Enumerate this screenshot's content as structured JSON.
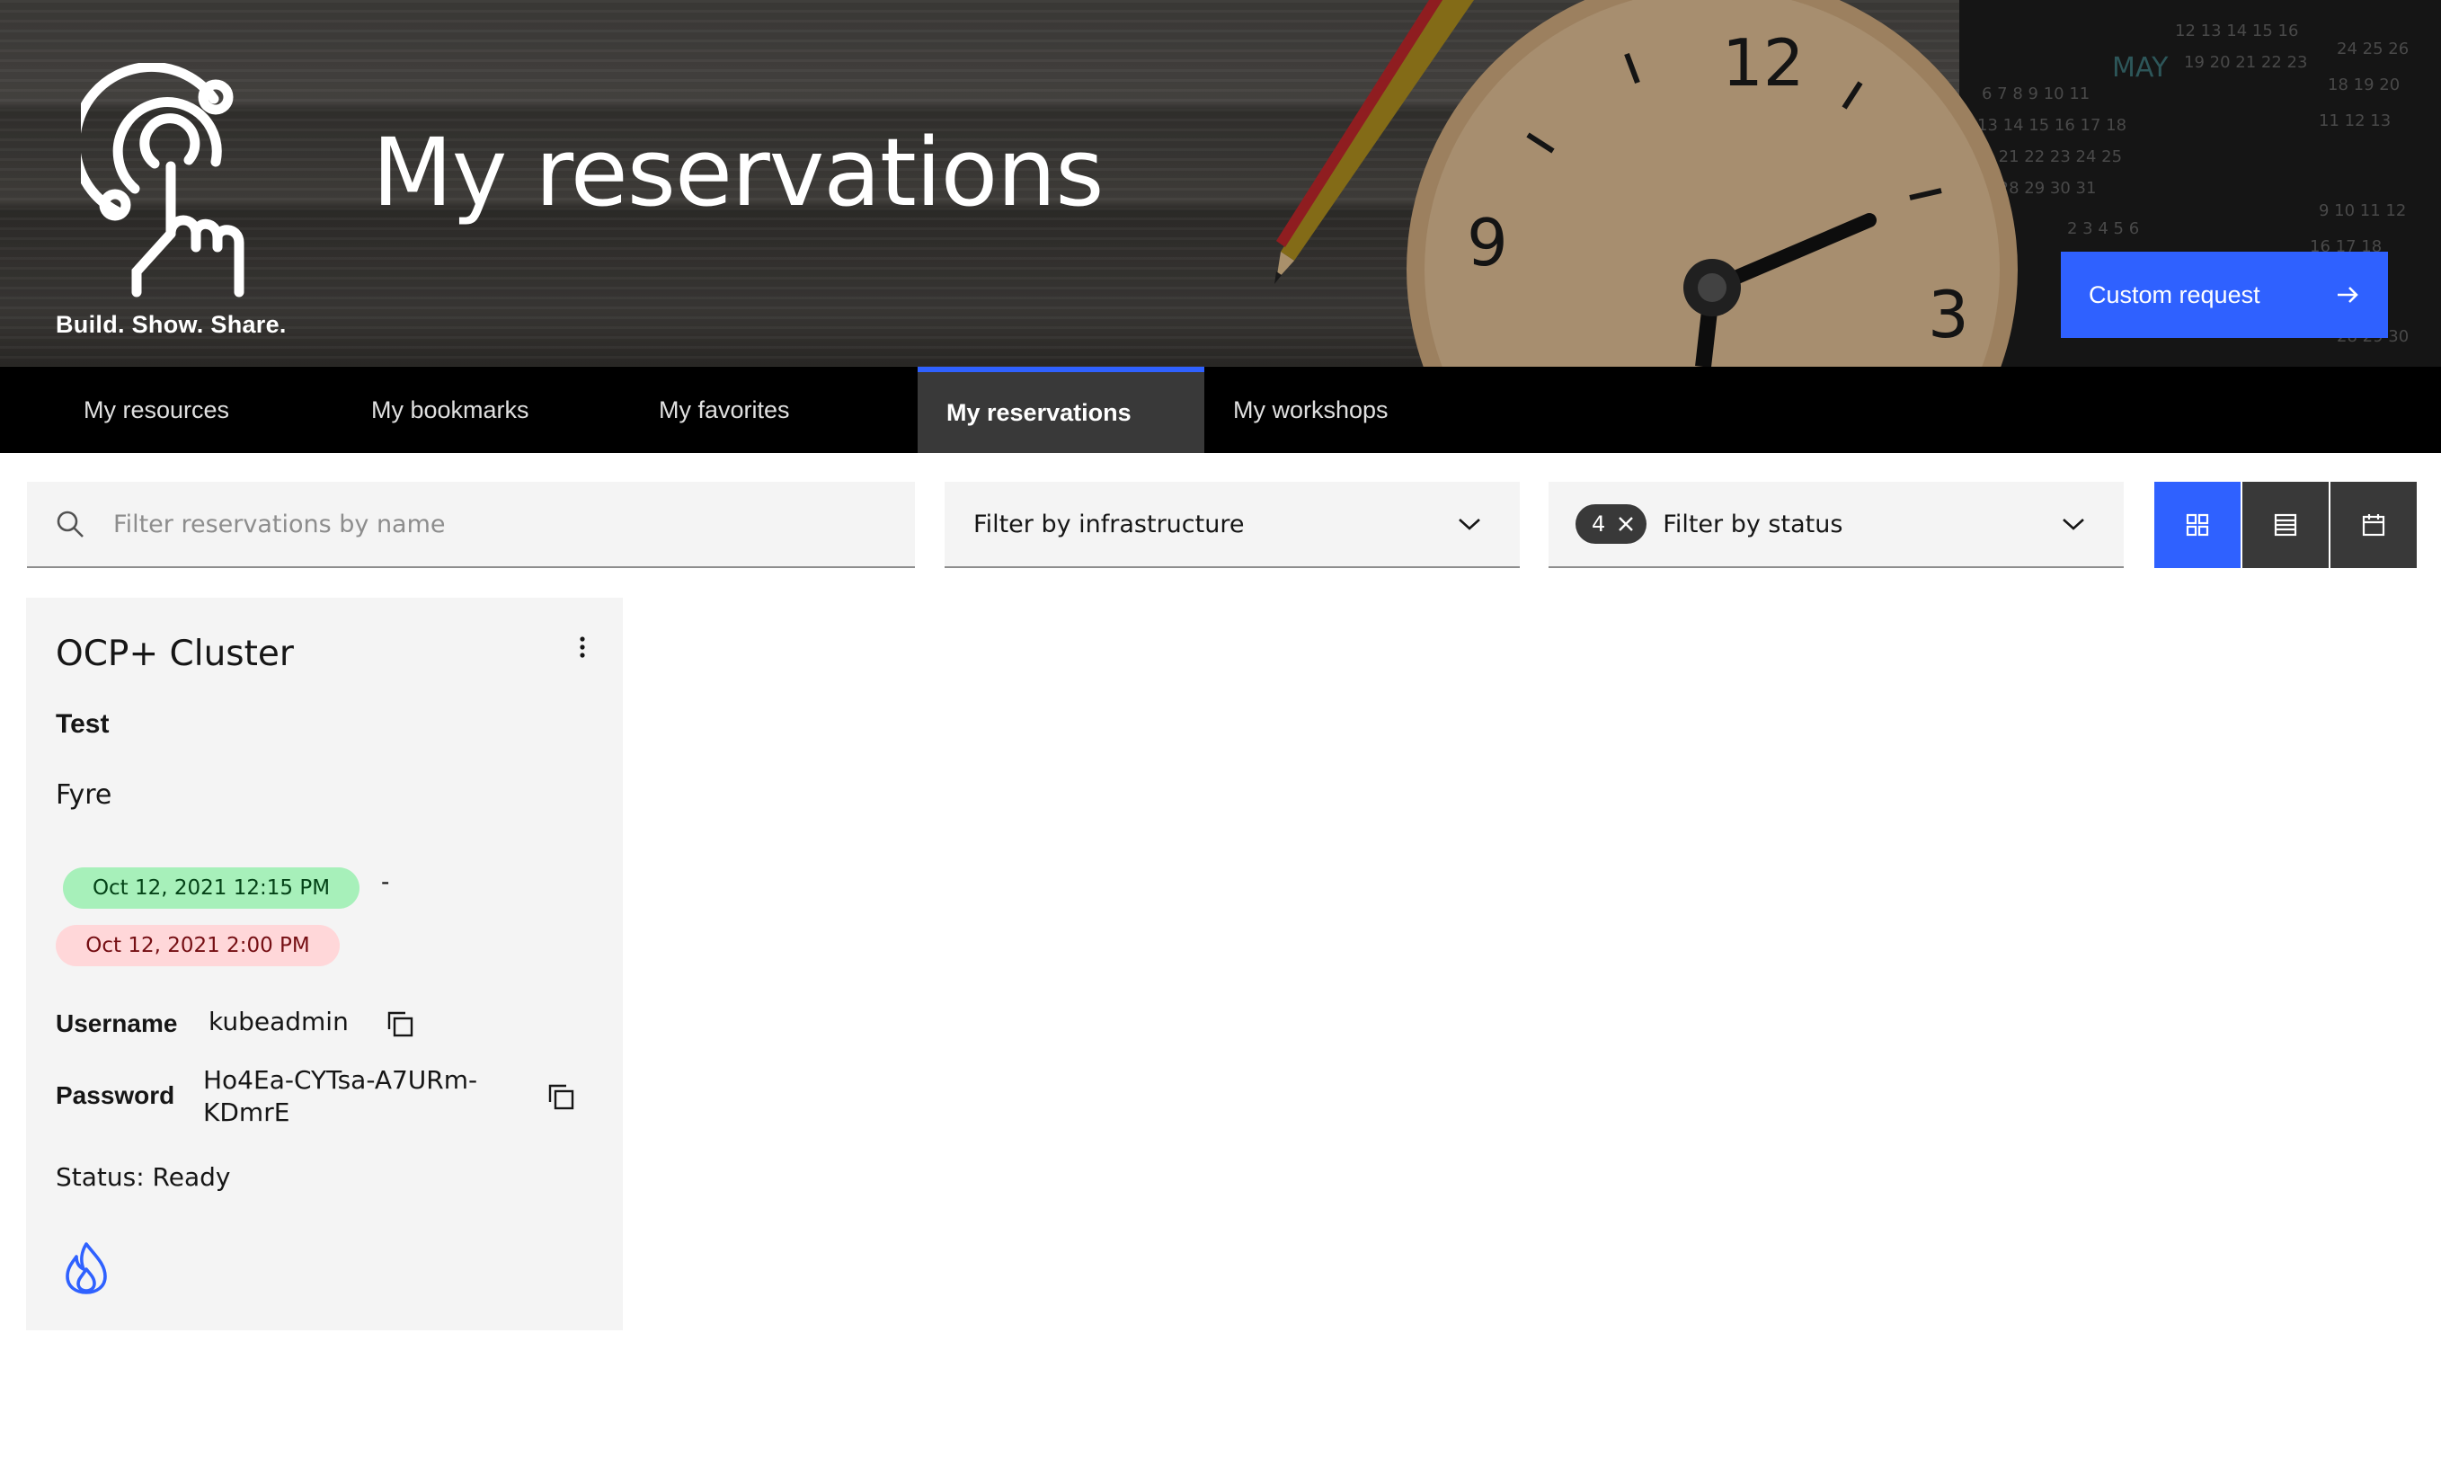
{
  "header": {
    "tagline": "Build. Show. Share.",
    "title": "My reservations",
    "custom_request_label": "Custom request",
    "clock_numbers": [
      "12",
      "9",
      "3"
    ],
    "calendar_month": "MAY"
  },
  "nav": {
    "tabs": [
      {
        "label": "My resources",
        "active": false
      },
      {
        "label": "My bookmarks",
        "active": false
      },
      {
        "label": "My favorites",
        "active": false
      },
      {
        "label": "My reservations",
        "active": true
      },
      {
        "label": "My workshops",
        "active": false
      }
    ]
  },
  "filters": {
    "search_placeholder": "Filter reservations by name",
    "infrastructure_label": "Filter by infrastructure",
    "status_label": "Filter by status",
    "status_count": "4"
  },
  "view_toggle": {
    "active": "grid"
  },
  "card": {
    "title": "OCP+ Cluster",
    "name": "Test",
    "owner": "Fyre",
    "start": "Oct 12, 2021 12:15 PM",
    "separator": "-",
    "end": "Oct 12, 2021 2:00 PM",
    "username_label": "Username",
    "username": "kubeadmin",
    "password_label": "Password",
    "password_line1": "Ho4Ea-CYTsa-A7URm-",
    "password_line2": "KDmrE",
    "status": "Status: Ready"
  },
  "colors": {
    "accent": "#2f61ff",
    "nav_bg": "#000000",
    "active_tab_bg": "#393939",
    "start_pill": "#a7f0ba",
    "end_pill": "#ffd7d9",
    "card_bg": "#f4f4f4"
  }
}
